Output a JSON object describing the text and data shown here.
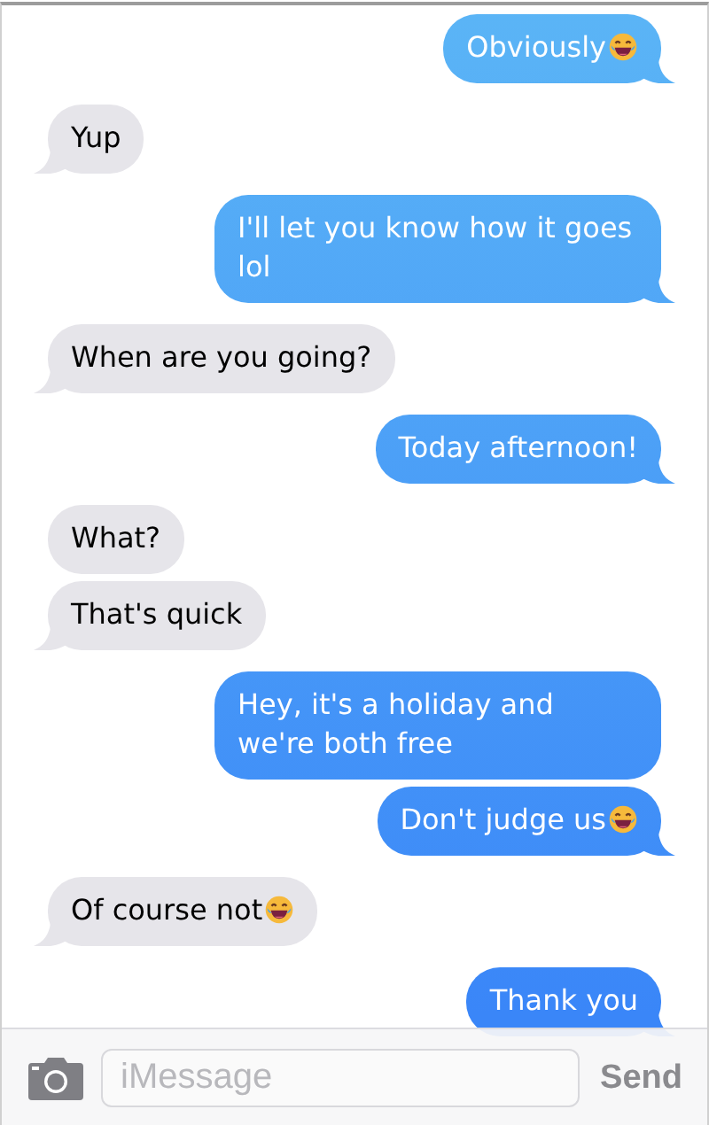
{
  "messages": [
    {
      "kind": "sent",
      "text": "Obviously",
      "trailing_emoji": true,
      "tail": true
    },
    {
      "kind": "received",
      "text": "Yup",
      "trailing_emoji": false,
      "tail": true
    },
    {
      "kind": "sent",
      "text": "I'll let you know how it goes lol",
      "trailing_emoji": false,
      "tail": true
    },
    {
      "kind": "received",
      "text": "When are you going?",
      "trailing_emoji": false,
      "tail": true
    },
    {
      "kind": "sent",
      "text": "Today afternoon!",
      "trailing_emoji": false,
      "tail": true
    },
    {
      "kind": "received",
      "text": "What?",
      "trailing_emoji": false,
      "tail": false
    },
    {
      "kind": "received",
      "text": "That's quick",
      "trailing_emoji": false,
      "tail": true
    },
    {
      "kind": "sent",
      "text": "Hey, it's a holiday and we're both free",
      "trailing_emoji": false,
      "tail": false
    },
    {
      "kind": "sent",
      "text": "Don't judge us",
      "trailing_emoji": true,
      "tail": true
    },
    {
      "kind": "received",
      "text": "Of course not",
      "trailing_emoji": true,
      "tail": true
    },
    {
      "kind": "sent",
      "text": "Thank you",
      "trailing_emoji": false,
      "tail": true
    }
  ],
  "compose": {
    "placeholder": "iMessage",
    "send_label": "Send"
  }
}
